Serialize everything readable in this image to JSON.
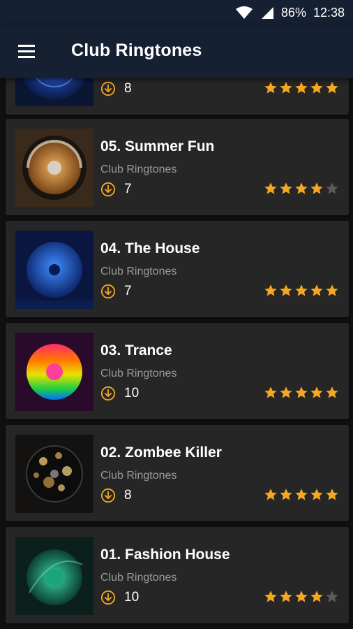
{
  "status": {
    "battery": "86%",
    "time": "12:38"
  },
  "appbar": {
    "title": "Club Ringtones"
  },
  "colors": {
    "accent": "#f5a623",
    "star_off": "#5a5a5a",
    "bar": "#152033",
    "card": "#262626"
  },
  "items": [
    {
      "title": "",
      "artist": "",
      "downloads": "8",
      "rating": 5,
      "art": "blue-disc-icon"
    },
    {
      "title": "05. Summer Fun",
      "artist": "Club Ringtones",
      "downloads": "7",
      "rating": 4,
      "art": "orange-disc-icon"
    },
    {
      "title": "04. The House",
      "artist": "Club Ringtones",
      "downloads": "7",
      "rating": 5,
      "art": "blue-disc-icon"
    },
    {
      "title": "03. Trance",
      "artist": "Club Ringtones",
      "downloads": "10",
      "rating": 5,
      "art": "rainbow-disc-icon"
    },
    {
      "title": "02. Zombee Killer",
      "artist": "Club Ringtones",
      "downloads": "8",
      "rating": 5,
      "art": "gold-bokeh-disc-icon"
    },
    {
      "title": "01. Fashion House",
      "artist": "Club Ringtones",
      "downloads": "10",
      "rating": 4,
      "art": "teal-disc-icon"
    }
  ]
}
